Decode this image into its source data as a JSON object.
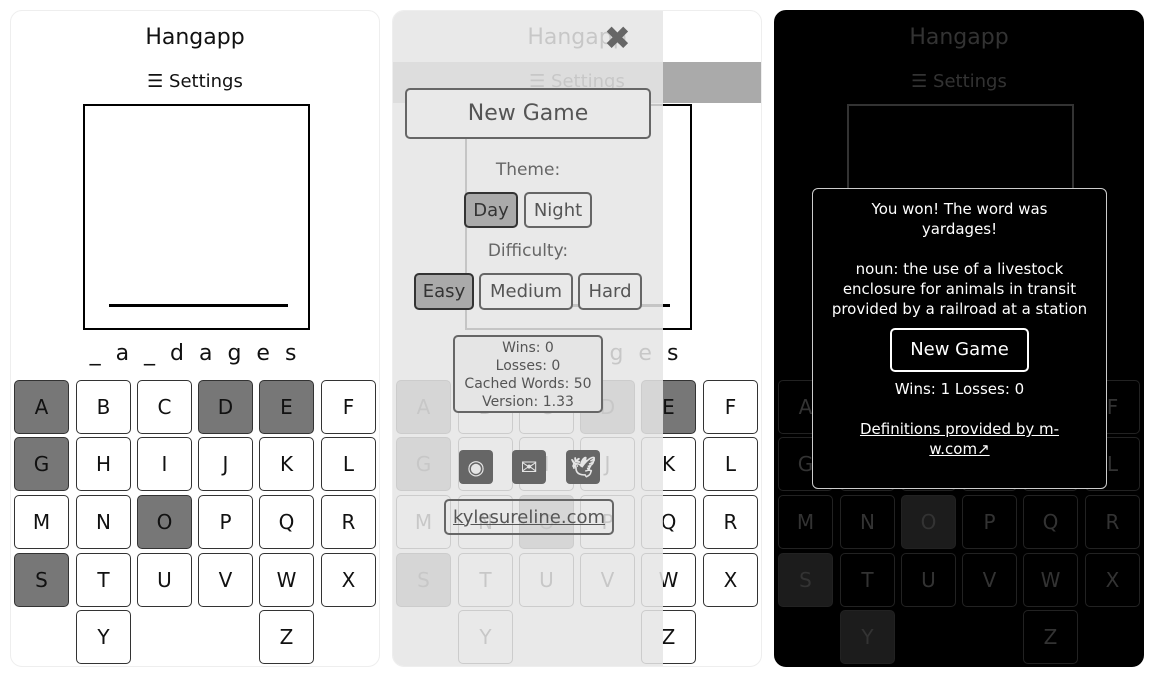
{
  "app": {
    "title": "Hangapp",
    "settings_label": "Settings",
    "menu_icon": "hamburger-icon"
  },
  "keyboard": [
    "A",
    "B",
    "C",
    "D",
    "E",
    "F",
    "G",
    "H",
    "I",
    "J",
    "K",
    "L",
    "M",
    "N",
    "O",
    "P",
    "Q",
    "R",
    "S",
    "T",
    "U",
    "V",
    "W",
    "X",
    "Y",
    "Z"
  ],
  "panel1": {
    "word": "_a_dages",
    "guessed": [
      "A",
      "D",
      "E",
      "G",
      "O",
      "S"
    ]
  },
  "panel2": {
    "word": "_a_dages",
    "guessed": [
      "A",
      "D",
      "E",
      "G",
      "O",
      "S"
    ],
    "drawer": {
      "close_icon": "close-x-icon",
      "new_game": "New Game",
      "theme_label": "Theme:",
      "theme_options": [
        "Day",
        "Night"
      ],
      "theme_selected": "Day",
      "difficulty_label": "Difficulty:",
      "difficulty_options": [
        "Easy",
        "Medium",
        "Hard"
      ],
      "difficulty_selected": "Easy",
      "stats": {
        "wins": "Wins: 0",
        "losses": "Losses: 0",
        "cached": "Cached Words: 50",
        "version": "Version: 1.33"
      },
      "social_icons": [
        "github-icon",
        "email-icon",
        "twitter-icon"
      ],
      "link": "kylesureline.com"
    }
  },
  "panel3": {
    "word": "yardages",
    "guessed": [
      "O",
      "S",
      "Y"
    ],
    "modal": {
      "result": "You won! The word was yardages!",
      "definition": "noun: the use of a livestock enclosure for animals in transit provided by a railroad at a station",
      "new_game": "New Game",
      "stats": "Wins: 1 Losses: 0",
      "credit": "Definitions provided by m-w.com"
    }
  }
}
